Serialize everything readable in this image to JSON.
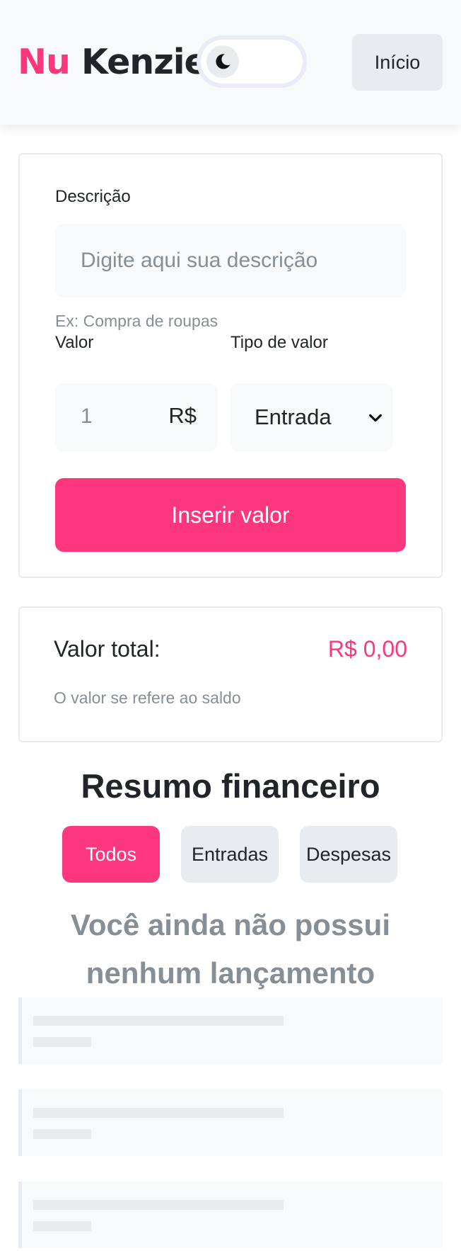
{
  "header": {
    "logo_part1": "Nu",
    "logo_part2": "Kenzie",
    "theme_toggle_icon": "moon-icon",
    "home_button": "Início"
  },
  "form": {
    "description_label": "Descrição",
    "description_placeholder": "Digite aqui sua descrição",
    "description_hint": "Ex: Compra de roupas",
    "value_label": "Valor",
    "value_input": "1",
    "currency": "R$",
    "type_label": "Tipo de valor",
    "type_selected": "Entrada",
    "submit_label": "Inserir valor"
  },
  "total": {
    "label": "Valor total:",
    "value": "R$ 0,00",
    "hint": "O valor se refere ao saldo"
  },
  "summary": {
    "title": "Resumo financeiro",
    "filters": [
      "Todos",
      "Entradas",
      "Despesas"
    ],
    "active_filter": "Todos",
    "empty_line1": "Você ainda não possui",
    "empty_line2": "nenhum lançamento"
  },
  "colors": {
    "brand": "#fd377e",
    "text": "#212529",
    "muted": "#868e96",
    "surface": "#f8f9fa",
    "border": "#e9ecef"
  }
}
